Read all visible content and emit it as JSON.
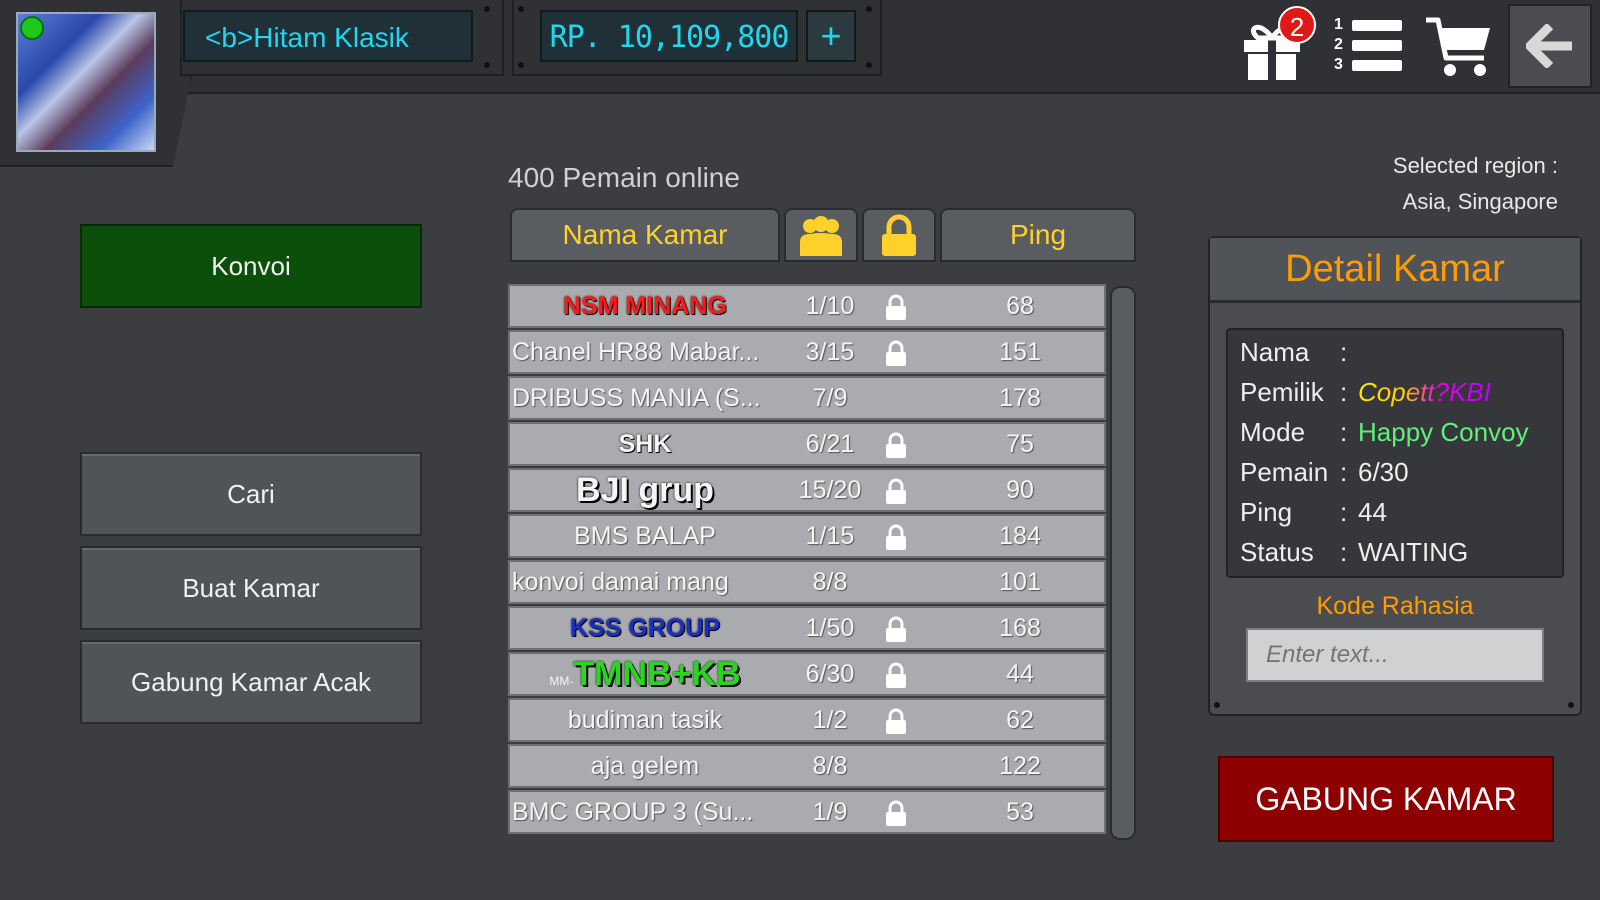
{
  "header": {
    "player_name": "<b>Hitam Klasik",
    "money": "RP. 10,109,800",
    "add_money_label": "+",
    "gift_badge_count": "2",
    "ranking_numbers": [
      "1",
      "2",
      "3"
    ]
  },
  "menu": {
    "items": [
      {
        "label": "Konvoi",
        "active": true
      },
      {
        "label": "Cari"
      },
      {
        "label": "Buat Kamar"
      },
      {
        "label": "Gabung Kamar Acak"
      }
    ]
  },
  "room_list": {
    "online_count_text": "400 Pemain online",
    "headers": {
      "name": "Nama Kamar",
      "players_icon": "players-icon",
      "lock_icon": "lock-icon",
      "ping": "Ping"
    },
    "rows": [
      {
        "name": "NSM MINANG",
        "players": "1/10",
        "locked": true,
        "ping": "68",
        "name_color": "#ff1a1a",
        "style": "bold"
      },
      {
        "name": "Chanel HR88 Mabar...",
        "players": "3/15",
        "locked": true,
        "ping": "151"
      },
      {
        "name": "DRIBUSS MANIA (S...",
        "players": "7/9",
        "locked": false,
        "ping": "178"
      },
      {
        "name": "SHK",
        "players": "6/21",
        "locked": true,
        "ping": "75",
        "style": "bold"
      },
      {
        "name": "BJI grup",
        "players": "15/20",
        "locked": true,
        "ping": "90",
        "style": "big"
      },
      {
        "name": "BMS BALAP",
        "players": "1/15",
        "locked": true,
        "ping": "184"
      },
      {
        "name": "konvoi damai mang",
        "players": "8/8",
        "locked": false,
        "ping": "101"
      },
      {
        "name": "KSS GROUP",
        "players": "1/50",
        "locked": true,
        "ping": "168",
        "name_color": "#1b2fc4",
        "style": "bold"
      },
      {
        "name": "TMNB+KB",
        "prefix": "MM-",
        "players": "6/30",
        "locked": true,
        "ping": "44",
        "name_color": "#2ad620",
        "style": "big"
      },
      {
        "name": "budiman tasik",
        "players": "1/2",
        "locked": true,
        "ping": "62"
      },
      {
        "name": "aja gelem",
        "players": "8/8",
        "locked": false,
        "ping": "122"
      },
      {
        "name": "BMC GROUP 3 (Su...",
        "players": "1/9",
        "locked": true,
        "ping": "53"
      }
    ]
  },
  "region": {
    "label": "Selected region :",
    "value": "Asia, Singapore"
  },
  "detail": {
    "title": "Detail Kamar",
    "fields": {
      "nama": {
        "label": "Nama",
        "value": ""
      },
      "pemilik": {
        "label": "Pemilik",
        "value": "Copett?KBI"
      },
      "mode": {
        "label": "Mode",
        "value": "Happy Convoy"
      },
      "pemain": {
        "label": "Pemain",
        "value": "6/30"
      },
      "ping": {
        "label": "Ping",
        "value": "44"
      },
      "status": {
        "label": "Status",
        "value": "WAITING"
      }
    },
    "colon": ":",
    "kode_label": "Kode Rahasia",
    "kode_placeholder": "Enter text...",
    "join_label": "GABUNG KAMAR"
  },
  "colors": {
    "accent_cyan": "#25d5ef",
    "accent_orange": "#ff9c00",
    "header_yellow": "#ffd12a",
    "active_green": "#0b4f0b",
    "join_red": "#8e0000"
  }
}
